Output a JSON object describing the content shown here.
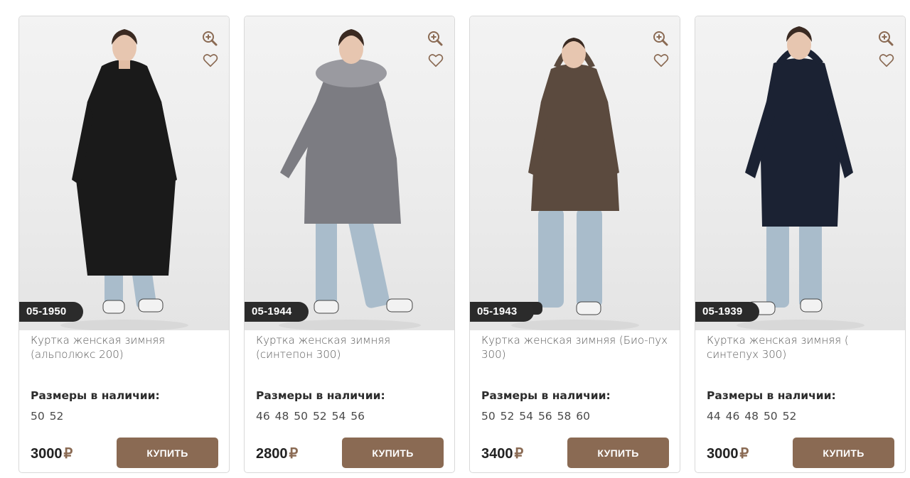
{
  "products": [
    {
      "sku": "05-1950",
      "title": "Куртка женская зимняя (альполюкс 200)",
      "sizes_label": "Размеры в наличии:",
      "sizes": "50 52",
      "price": "3000",
      "currency": "₽",
      "buy_label": "купить",
      "coat_color": "#1a1a1a",
      "icons": {
        "zoom": "zoom-in-icon",
        "favorite": "heart-icon"
      }
    },
    {
      "sku": "05-1944",
      "title": "Куртка женская зимняя (синтепон 300)",
      "sizes_label": "Размеры в наличии:",
      "sizes": "46 48 50 52 54 56",
      "price": "2800",
      "currency": "₽",
      "buy_label": "купить",
      "coat_color": "#7c7c82",
      "icons": {
        "zoom": "zoom-in-icon",
        "favorite": "heart-icon"
      }
    },
    {
      "sku": "05-1943",
      "title": "Куртка женская зимняя (Био-пух 300)",
      "sizes_label": "Размеры в наличии:",
      "sizes": "50 52 54 56 58 60",
      "price": "3400",
      "currency": "₽",
      "buy_label": "купить",
      "coat_color": "#5b4a3e",
      "icons": {
        "zoom": "zoom-in-icon",
        "favorite": "heart-icon"
      }
    },
    {
      "sku": "05-1939",
      "title": "Куртка женская зимняя ( синтепух 300)",
      "sizes_label": "Размеры в наличии:",
      "sizes": "44 46 48 50 52",
      "price": "3000",
      "currency": "₽",
      "buy_label": "купить",
      "coat_color": "#1b2233",
      "icons": {
        "zoom": "zoom-in-icon",
        "favorite": "heart-icon"
      }
    }
  ],
  "colors": {
    "accent": "#8a6a53",
    "sku_badge": "#2b2b2b",
    "jeans": "#a9bccb",
    "icon": "#8a6a53"
  }
}
